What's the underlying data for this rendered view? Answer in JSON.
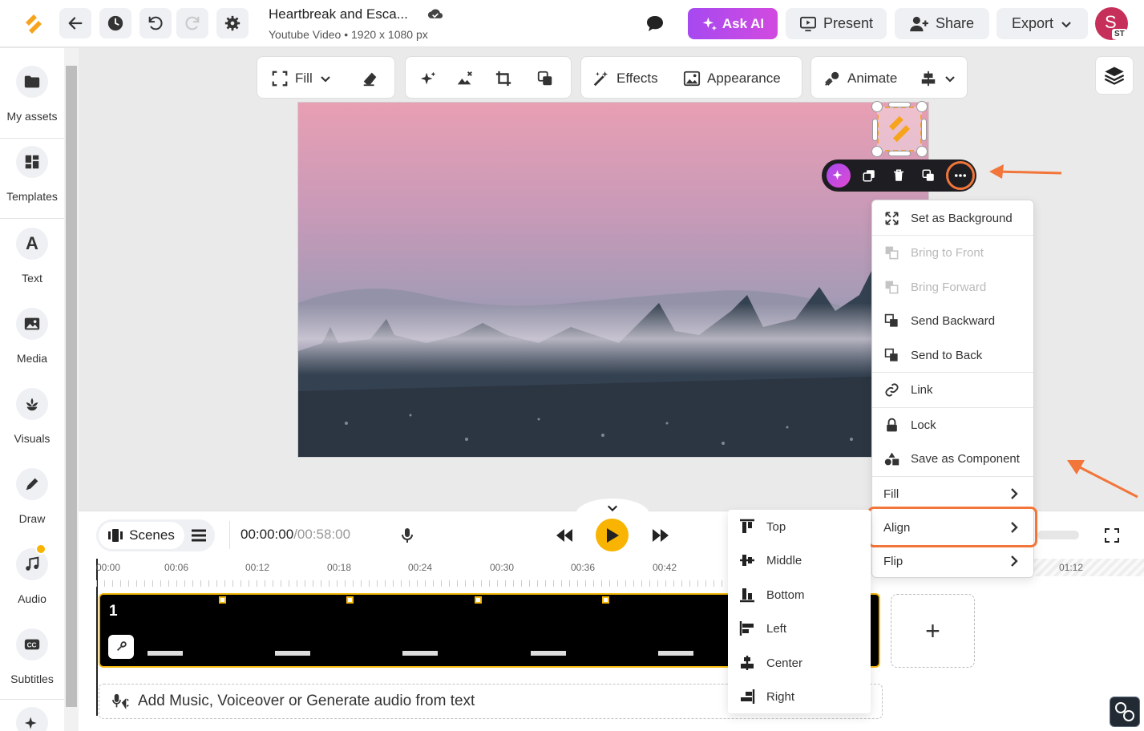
{
  "header": {
    "doc_title": "Heartbreak and Esca...",
    "doc_subtitle": "Youtube Video • 1920 x 1080 px",
    "ask_ai_label": "Ask AI",
    "present_label": "Present",
    "share_label": "Share",
    "export_label": "Export",
    "avatar_initial": "S",
    "avatar_badge": "ST"
  },
  "sidebar": {
    "items": [
      {
        "label": "My assets",
        "icon": "folder-icon"
      },
      {
        "label": "Templates",
        "icon": "templates-icon"
      },
      {
        "label": "Text",
        "icon": "text-icon"
      },
      {
        "label": "Media",
        "icon": "image-icon"
      },
      {
        "label": "Visuals",
        "icon": "visuals-icon"
      },
      {
        "label": "Draw",
        "icon": "pen-icon"
      },
      {
        "label": "Audio",
        "icon": "music-icon"
      },
      {
        "label": "Subtitles",
        "icon": "cc-icon"
      }
    ],
    "text_glyph": "A"
  },
  "toolbar": {
    "fill_label": "Fill",
    "effects_label": "Effects",
    "appearance_label": "Appearance",
    "animate_label": "Animate"
  },
  "context_menu": {
    "items": [
      {
        "label": "Set as Background",
        "enabled": true
      },
      {
        "label": "Bring to Front",
        "enabled": false
      },
      {
        "label": "Bring Forward",
        "enabled": false
      },
      {
        "label": "Send Backward",
        "enabled": true
      },
      {
        "label": "Send to Back",
        "enabled": true
      },
      {
        "label": "Link",
        "enabled": true
      },
      {
        "label": "Lock",
        "enabled": true
      },
      {
        "label": "Save as Component",
        "enabled": true
      },
      {
        "label": "Fill",
        "enabled": true
      },
      {
        "label": "Align",
        "enabled": true
      },
      {
        "label": "Flip",
        "enabled": true
      }
    ]
  },
  "align_submenu": {
    "items": [
      "Top",
      "Middle",
      "Bottom",
      "Left",
      "Center",
      "Right"
    ]
  },
  "timeline": {
    "scenes_label": "Scenes",
    "current_time": "00:00:00",
    "duration": "/00:58:00",
    "ruler": [
      "00:00",
      "00:06",
      "00:12",
      "00:18",
      "00:24",
      "00:30",
      "00:36",
      "00:42",
      "01:12"
    ],
    "scene_number": "1",
    "add_scene": "+",
    "audio_prompt": "Add Music, Voiceover or Generate audio from text"
  },
  "colors": {
    "accent_orange": "#f2753a",
    "play_yellow": "#f8b400",
    "ask_ai_purple": "#a649f0"
  }
}
